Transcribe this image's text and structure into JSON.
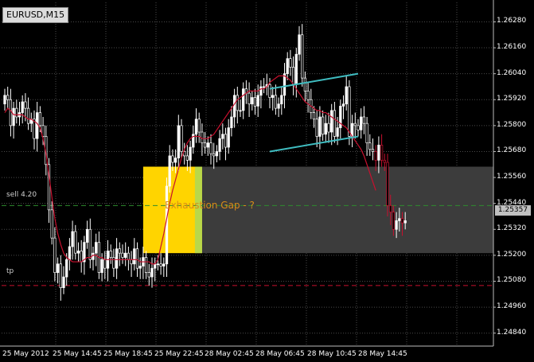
{
  "window": {
    "symbol": "EURUSD,M15"
  },
  "colors": {
    "background": "#000000",
    "grid": "#4a4a4a",
    "candle": "#ffffff",
    "bearish_candle": "#c8102e",
    "moving_average": "#c8102e",
    "channel": "#3fbcc0",
    "sell_line": "#2e8b2e",
    "tp_line": "#c8102e",
    "zone_gray": "#3c3c3c",
    "zone_yellow": "#ffd400",
    "zone_green": "#b8d84a",
    "annotation": "#d98b18"
  },
  "price_axis": [
    "1.26280",
    "1.26160",
    "1.26040",
    "1.25920",
    "1.25800",
    "1.25680",
    "1.25560",
    "1.25440",
    "1.25320",
    "1.25200",
    "1.25080",
    "1.24960",
    "1.24840"
  ],
  "time_axis": [
    "25 May 2012",
    "25 May 14:45",
    "25 May 18:45",
    "25 May 22:45",
    "28 May 02:45",
    "28 May 06:45",
    "28 May 10:45",
    "28 May 14:45"
  ],
  "current_price": "1.25357",
  "lines": {
    "sell": {
      "label": "sell 4.20",
      "price": 1.2543
    },
    "tp": {
      "label": "tp",
      "price": 1.2506
    }
  },
  "annotation": {
    "text": "Exhaustion  Gap - ?"
  },
  "chart_data": {
    "type": "candlestick",
    "ylim": [
      1.2478,
      1.2637
    ],
    "series": [
      {
        "name": "EURUSD,M15",
        "close": [
          1.2594,
          1.2592,
          1.258,
          1.2588,
          1.2584,
          1.2586,
          1.2591,
          1.2588,
          1.2581,
          1.2583,
          1.2574,
          1.2586,
          1.258,
          1.2575,
          1.2562,
          1.2541,
          1.2528,
          1.2512,
          1.2516,
          1.2505,
          1.251,
          1.2518,
          1.2524,
          1.2531,
          1.2521,
          1.2522,
          1.2517,
          1.2526,
          1.2532,
          1.2518,
          1.2521,
          1.2526,
          1.2512,
          1.2518,
          1.2514,
          1.2522,
          1.2519,
          1.2514,
          1.2523,
          1.2521,
          1.2519,
          1.2521,
          1.2518,
          1.2516,
          1.2523,
          1.2514,
          1.2515,
          1.2519,
          1.2512,
          1.251,
          1.2514,
          1.2516,
          1.2516,
          1.2515,
          1.2516,
          1.2552,
          1.2566,
          1.2563,
          1.2565,
          1.258,
          1.2568,
          1.2566,
          1.2564,
          1.257,
          1.2576,
          1.2583,
          1.2577,
          1.2572,
          1.257,
          1.2572,
          1.2567,
          1.2566,
          1.2568,
          1.2574,
          1.2576,
          1.257,
          1.2579,
          1.2584,
          1.2594,
          1.2587,
          1.2587,
          1.2597,
          1.2595,
          1.259,
          1.2593,
          1.2589,
          1.2594,
          1.2598,
          1.2598,
          1.2599,
          1.2593,
          1.2594,
          1.2588,
          1.259,
          1.2594,
          1.2604,
          1.2611,
          1.2607,
          1.2599,
          1.2613,
          1.2622,
          1.2602,
          1.2596,
          1.2592,
          1.2586,
          1.2583,
          1.2575,
          1.2584,
          1.2576,
          1.2581,
          1.2577,
          1.2587,
          1.2575,
          1.2579,
          1.2589,
          1.259,
          1.2598,
          1.2575,
          1.2581,
          1.258,
          1.2578,
          1.2584,
          1.2581,
          1.2572,
          1.2569,
          1.2568,
          1.2564,
          1.2571,
          1.2564,
          1.2563,
          1.2543,
          1.254,
          1.2532,
          1.2536,
          1.2537,
          1.2535,
          1.2536
        ]
      },
      {
        "name": "MA",
        "values": [
          1.2586,
          1.2588,
          1.2587,
          1.2585,
          1.2585,
          1.2585,
          1.2585,
          1.2584,
          1.2583,
          1.2583,
          1.2582,
          1.2581,
          1.2579,
          1.2574,
          1.2567,
          1.2557,
          1.2547,
          1.2537,
          1.253,
          1.2525,
          1.2521,
          1.2519,
          1.2518,
          1.2517,
          1.2517,
          1.2517,
          1.2517,
          1.2518,
          1.2519,
          1.2519,
          1.252,
          1.252,
          1.2519,
          1.2519,
          1.2518,
          1.2518,
          1.2518,
          1.2518,
          1.2518,
          1.2518,
          1.2518,
          1.2518,
          1.2518,
          1.2518,
          1.2518,
          1.2518,
          1.2517,
          1.2517,
          1.2517,
          1.2517,
          1.2516,
          1.2516,
          1.2518,
          1.2524,
          1.253,
          1.2537,
          1.2544,
          1.255,
          1.2555,
          1.256,
          1.2565,
          1.2569,
          1.2572,
          1.2574,
          1.2575,
          1.2575,
          1.2575,
          1.2574,
          1.2574,
          1.2574,
          1.2575,
          1.2576,
          1.2578,
          1.258,
          1.2582,
          1.2584,
          1.2586,
          1.2588,
          1.259,
          1.2592,
          1.2593,
          1.2594,
          1.2595,
          1.2596,
          1.2596,
          1.2596,
          1.2596,
          1.2597,
          1.2597,
          1.2598,
          1.26,
          1.2601,
          1.2602,
          1.2603,
          1.2603,
          1.2603,
          1.2602,
          1.2601,
          1.2599,
          1.2597,
          1.2595,
          1.2593,
          1.2591,
          1.259,
          1.2589,
          1.2588,
          1.2587,
          1.2587,
          1.2586,
          1.2586,
          1.2585,
          1.2584,
          1.2583,
          1.2582,
          1.2581,
          1.258,
          1.2579,
          1.2577,
          1.2575,
          1.2573,
          1.2571,
          1.2569,
          1.2566,
          1.2562,
          1.2558,
          1.2554,
          1.255
        ]
      }
    ],
    "channel_lines": [
      {
        "from": [
          90,
          1.2597
        ],
        "to": [
          120,
          1.2604
        ]
      },
      {
        "from": [
          90,
          1.2568
        ],
        "to": [
          120,
          1.2575
        ]
      }
    ],
    "zones": [
      {
        "name": "gap",
        "x_from": 47,
        "x_to": 67,
        "y_from": 1.2521,
        "y_to": 1.2561
      },
      {
        "name": "range",
        "x_from": 67,
        "x_to": 150,
        "y_from": 1.2521,
        "y_to": 1.2561
      }
    ]
  }
}
